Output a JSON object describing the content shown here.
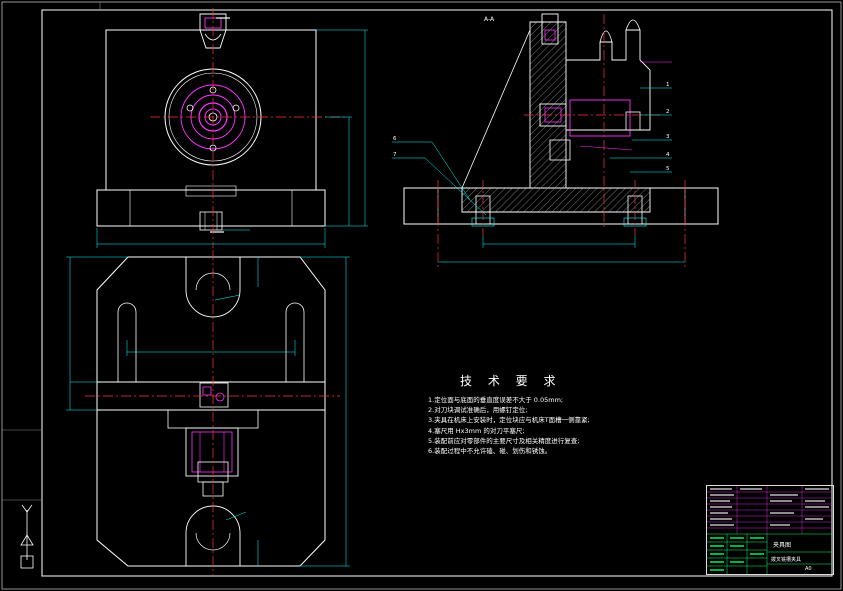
{
  "section_label": "A-A",
  "tech_requirements": {
    "title": "技 术 要 求",
    "items": [
      "1.定位面与底面的垂直度误差不大于 0.05mm;",
      "2.对刀块调试准确后，用螺钉定位;",
      "3.夹具在机床上安装时，定位块应与机床T面槽一侧靠紧;",
      "4.塞尺用 Hx3mm 的对刀平塞尺;",
      "5.装配前应对零部件的主要尺寸及相关精度进行复查;",
      "6.装配过程中不允许磕、碰、划伤和锈蚀。"
    ]
  },
  "title_block": {
    "title": "夹具图",
    "subtitle": "拨叉铣槽夹具",
    "sheet": "A0"
  },
  "part_numbers": [
    "1",
    "2",
    "3",
    "4",
    "5",
    "6",
    "7"
  ],
  "colors": {
    "background": "#000000",
    "outline": "#ffffff",
    "center_line": "#ff3333",
    "dimension": "#00ffff",
    "part": "#ff33ff",
    "hatch": "#bbbbbb",
    "table_green": "#00ff66"
  }
}
